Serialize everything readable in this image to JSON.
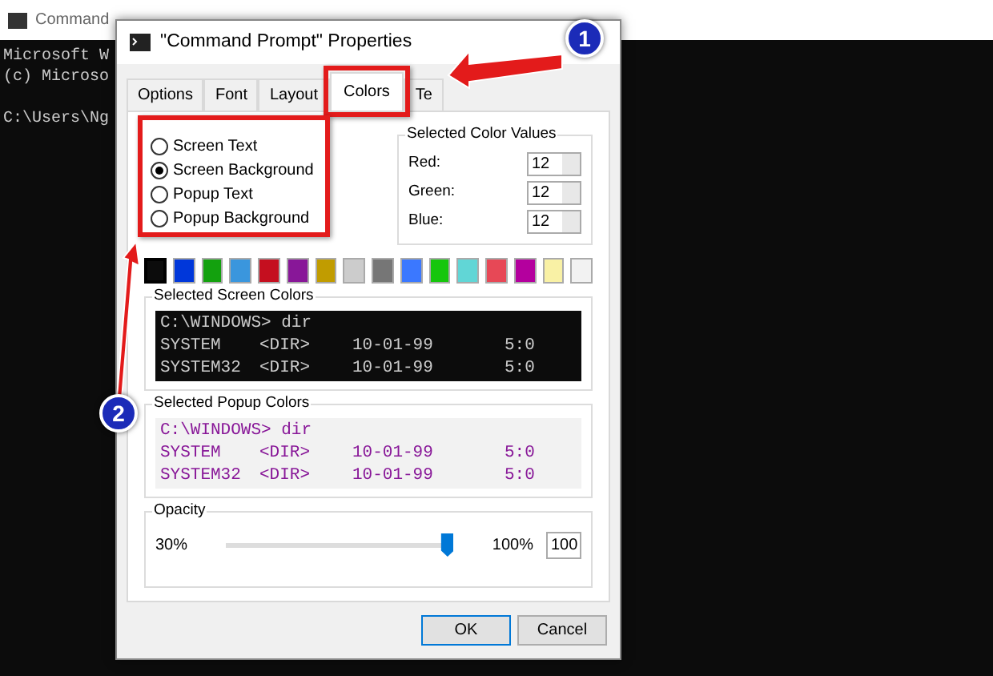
{
  "console": {
    "title": "Command",
    "lines": [
      "Microsoft W",
      "(c) Microso",
      "C:\\Users\\Ng"
    ]
  },
  "dialog": {
    "title": "\"Command Prompt\" Properties",
    "tabs": [
      {
        "label": "Options",
        "selected": false
      },
      {
        "label": "Font",
        "selected": false
      },
      {
        "label": "Layout",
        "selected": false
      },
      {
        "label": "Colors",
        "selected": true
      },
      {
        "label": "Te",
        "selected": false
      }
    ],
    "targets": [
      {
        "label": "Screen Text",
        "selected": false
      },
      {
        "label": "Screen Background",
        "selected": true
      },
      {
        "label": "Popup Text",
        "selected": false
      },
      {
        "label": "Popup Background",
        "selected": false
      }
    ],
    "color_values": {
      "title": "Selected Color Values",
      "fields": [
        {
          "label": "Red:",
          "value": "12"
        },
        {
          "label": "Green:",
          "value": "12"
        },
        {
          "label": "Blue:",
          "value": "12"
        }
      ]
    },
    "swatches": [
      {
        "color": "#0c0c0c",
        "selected": true
      },
      {
        "color": "#0037da",
        "selected": false
      },
      {
        "color": "#13a10e",
        "selected": false
      },
      {
        "color": "#3a96dd",
        "selected": false
      },
      {
        "color": "#c50f1f",
        "selected": false
      },
      {
        "color": "#881798",
        "selected": false
      },
      {
        "color": "#c19c00",
        "selected": false
      },
      {
        "color": "#cccccc",
        "selected": false
      },
      {
        "color": "#767676",
        "selected": false
      },
      {
        "color": "#3b78ff",
        "selected": false
      },
      {
        "color": "#16c60c",
        "selected": false
      },
      {
        "color": "#61d6d6",
        "selected": false
      },
      {
        "color": "#e74856",
        "selected": false
      },
      {
        "color": "#b4009e",
        "selected": false
      },
      {
        "color": "#f9f1a5",
        "selected": false
      },
      {
        "color": "#f2f2f2",
        "selected": false
      }
    ],
    "previews": [
      {
        "title": "Selected Screen Colors",
        "kind": "screen",
        "lines": [
          [
            "C:\\WINDOWS> dir"
          ],
          [
            "SYSTEM",
            "<DIR>",
            "10-01-99",
            "5:0"
          ],
          [
            "SYSTEM32",
            "<DIR>",
            "10-01-99",
            "5:0"
          ]
        ]
      },
      {
        "title": "Selected Popup Colors",
        "kind": "popup",
        "lines": [
          [
            "C:\\WINDOWS> dir"
          ],
          [
            "SYSTEM",
            "<DIR>",
            "10-01-99",
            "5:0"
          ],
          [
            "SYSTEM32",
            "<DIR>",
            "10-01-99",
            "5:0"
          ]
        ]
      }
    ],
    "opacity": {
      "title": "Opacity",
      "min_label": "30%",
      "max_label": "100%",
      "value": "100",
      "level": 1
    },
    "buttons": [
      {
        "label": "OK",
        "default": true
      },
      {
        "label": "Cancel",
        "default": false
      }
    ]
  },
  "annotations": [
    {
      "number": "1"
    },
    {
      "number": "2"
    }
  ]
}
